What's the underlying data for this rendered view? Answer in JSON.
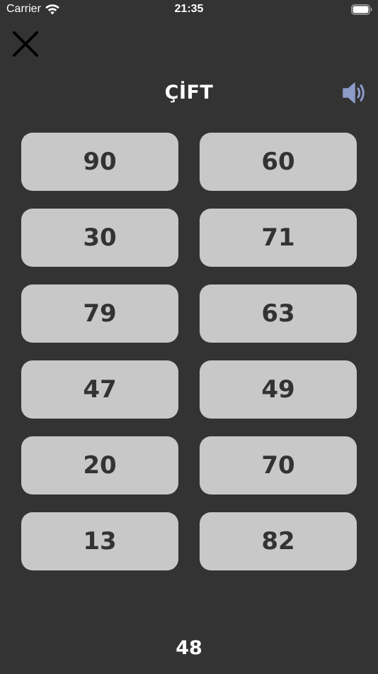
{
  "status_bar": {
    "carrier": "Carrier",
    "time": "21:35",
    "wifi_icon": "wifi-icon",
    "battery_icon": "battery-icon"
  },
  "header": {
    "close_icon": "close-icon",
    "title": "ÇİFT",
    "speaker_icon": "speaker-icon",
    "speaker_color": "#8c9bc8"
  },
  "numbers": [
    "90",
    "60",
    "30",
    "71",
    "79",
    "63",
    "47",
    "49",
    "20",
    "70",
    "13",
    "82"
  ],
  "footer": {
    "counter": "48"
  },
  "colors": {
    "background": "#333333",
    "button": "#c8c8c8",
    "button_text": "#333333",
    "text": "#ffffff"
  }
}
